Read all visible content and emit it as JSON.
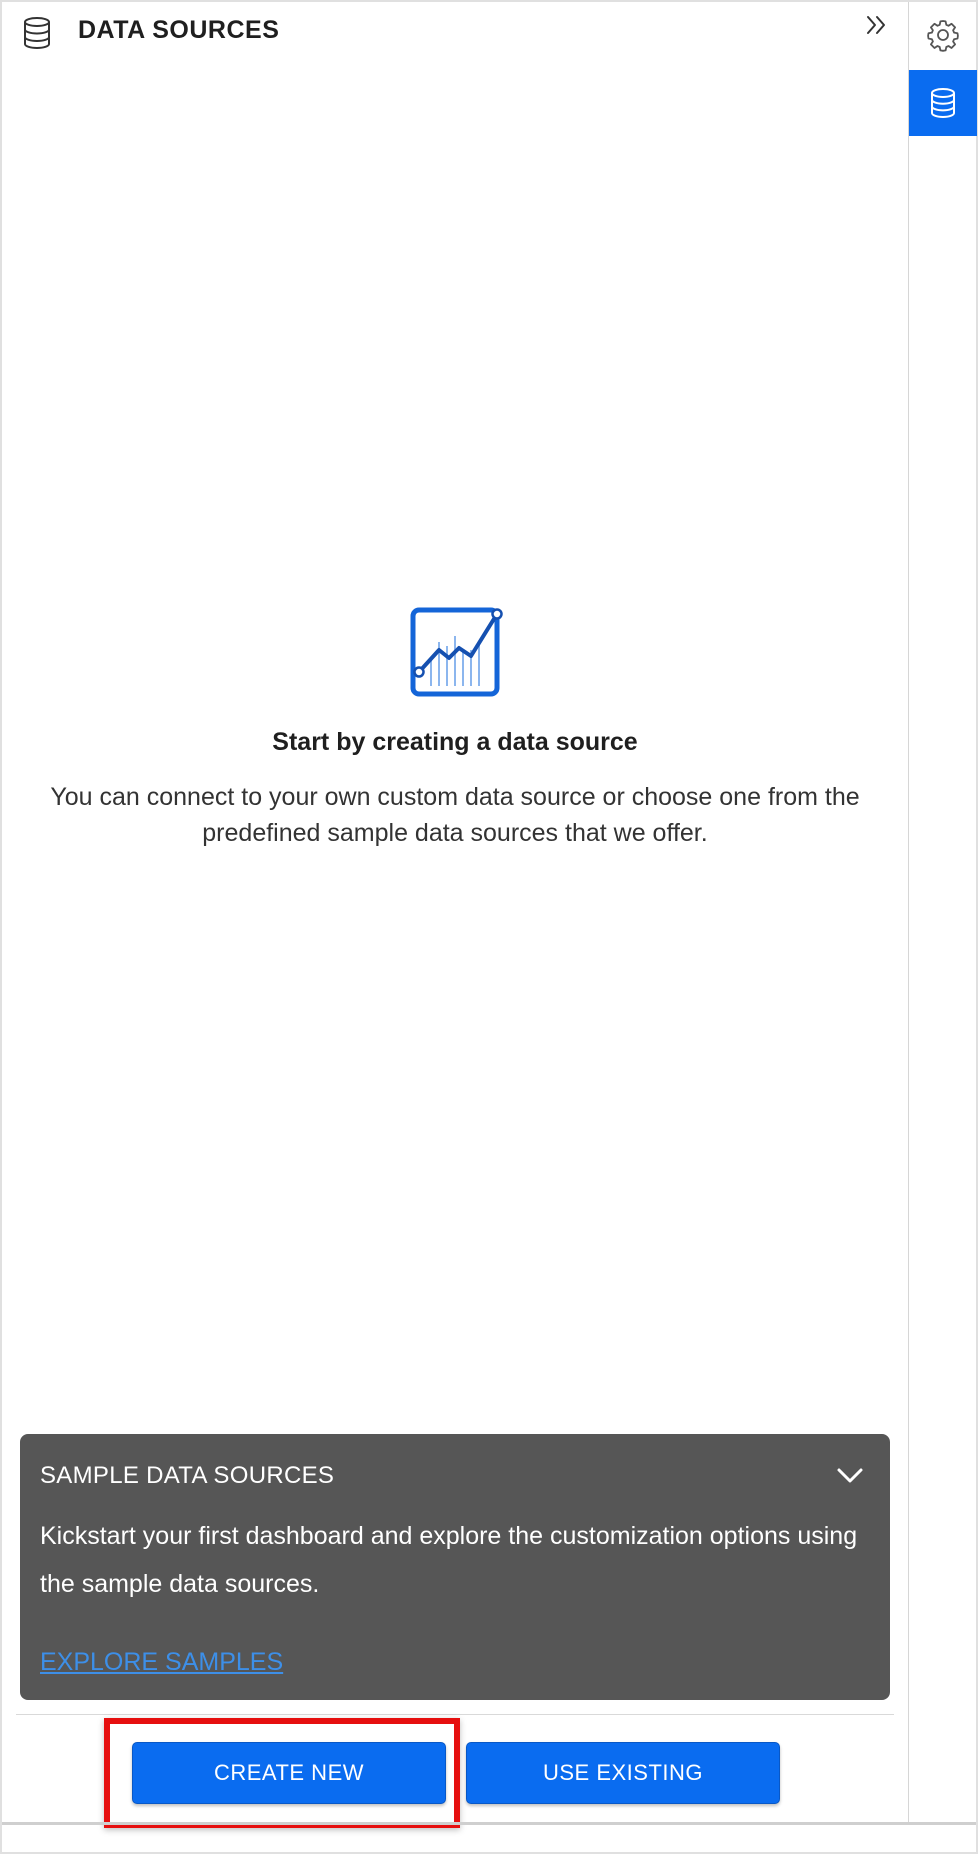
{
  "header": {
    "title": "DATA SOURCES",
    "icon": "database-icon",
    "collapse_icon": "double-chevron-right-icon"
  },
  "empty_state": {
    "icon": "line-chart-icon",
    "title": "Start by creating a data source",
    "description": "You can connect to your own custom data source or choose one from the predefined sample data sources that we offer."
  },
  "sample_card": {
    "title": "SAMPLE DATA SOURCES",
    "description": "Kickstart your first dashboard and explore the customization options using the sample data sources.",
    "link_label": "EXPLORE SAMPLES",
    "toggle_icon": "chevron-down-icon"
  },
  "actions": {
    "create_label": "CREATE NEW",
    "existing_label": "USE EXISTING"
  },
  "rail": {
    "items": [
      {
        "name": "settings",
        "icon": "gear-icon",
        "active": false
      },
      {
        "name": "data-sources",
        "icon": "database-icon",
        "active": true
      }
    ]
  },
  "colors": {
    "accent": "#0a6cf0",
    "card_background": "#565656",
    "link": "#3d8fe8",
    "highlight": "#e60f0f"
  }
}
